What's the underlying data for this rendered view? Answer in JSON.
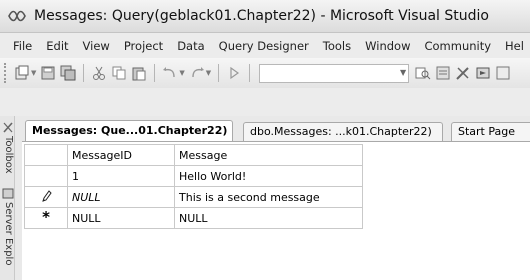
{
  "window": {
    "title": "Messages: Query(geblack01.Chapter22) - Microsoft Visual Studio"
  },
  "menu": {
    "items": [
      "File",
      "Edit",
      "View",
      "Project",
      "Data",
      "Query Designer",
      "Tools",
      "Window",
      "Community",
      "Hel"
    ]
  },
  "sidebar": {
    "toolbox_label": "Toolbox",
    "server_explorer_label": "Server Explo"
  },
  "tabs": [
    {
      "label": "Messages: Que...01.Chapter22)",
      "active": true
    },
    {
      "label": "dbo.Messages: ...k01.Chapter22)",
      "active": false
    },
    {
      "label": "Start Page",
      "active": false
    }
  ],
  "grid": {
    "columns": [
      "MessageID",
      "Message"
    ],
    "rows": [
      {
        "indicator": "",
        "values": [
          "1",
          "Hello World!"
        ]
      },
      {
        "indicator": "pencil-icon",
        "values": [
          "NULL",
          "This is a second message"
        ]
      },
      {
        "indicator": "asterisk-icon",
        "values": [
          "NULL",
          "NULL"
        ]
      }
    ]
  },
  "colors": {
    "titlebar": "#dcdcdc",
    "menubar": "#ececec",
    "grid_border": "#c9c9c9"
  }
}
